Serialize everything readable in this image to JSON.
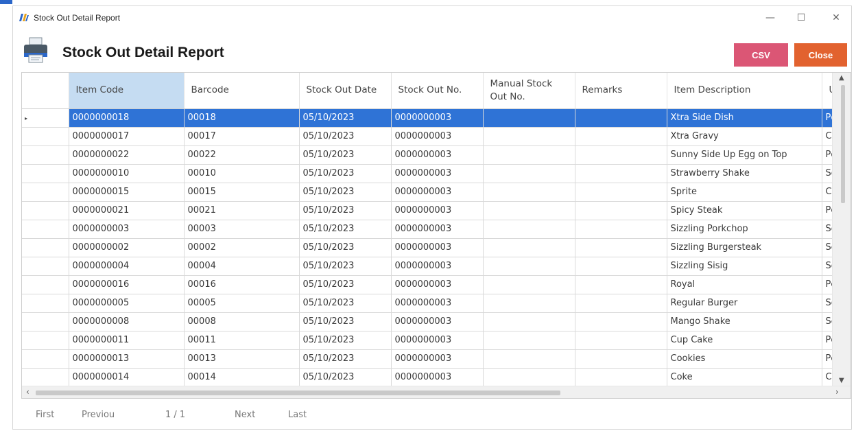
{
  "window": {
    "title": "Stock Out Detail Report",
    "minimize_glyph": "—",
    "maximize_glyph": "☐",
    "close_glyph": "✕"
  },
  "header": {
    "title": "Stock Out Detail Report",
    "csv_label": "CSV",
    "close_label": "Close"
  },
  "table": {
    "columns": [
      {
        "label": "Item Code"
      },
      {
        "label": "Barcode"
      },
      {
        "label": "Stock Out Date"
      },
      {
        "label": "Stock Out No."
      },
      {
        "label": "Manual Stock Out No."
      },
      {
        "label": "Remarks"
      },
      {
        "label": "Item Description"
      },
      {
        "label": "U"
      }
    ],
    "rows": [
      {
        "item_code": "0000000018",
        "barcode": "00018",
        "date": "05/10/2023",
        "stock_out_no": "0000000003",
        "manual_no": "",
        "remarks": "",
        "description": "Xtra Side Dish",
        "unit": "Pc"
      },
      {
        "item_code": "0000000017",
        "barcode": "00017",
        "date": "05/10/2023",
        "stock_out_no": "0000000003",
        "manual_no": "",
        "remarks": "",
        "description": "Xtra Gravy",
        "unit": "Cu"
      },
      {
        "item_code": "0000000022",
        "barcode": "00022",
        "date": "05/10/2023",
        "stock_out_no": "0000000003",
        "manual_no": "",
        "remarks": "",
        "description": "Sunny Side Up Egg on Top",
        "unit": "Pc"
      },
      {
        "item_code": "0000000010",
        "barcode": "00010",
        "date": "05/10/2023",
        "stock_out_no": "0000000003",
        "manual_no": "",
        "remarks": "",
        "description": "Strawberry Shake",
        "unit": "Se"
      },
      {
        "item_code": "0000000015",
        "barcode": "00015",
        "date": "05/10/2023",
        "stock_out_no": "0000000003",
        "manual_no": "",
        "remarks": "",
        "description": "Sprite",
        "unit": "Ca"
      },
      {
        "item_code": "0000000021",
        "barcode": "00021",
        "date": "05/10/2023",
        "stock_out_no": "0000000003",
        "manual_no": "",
        "remarks": "",
        "description": "Spicy Steak",
        "unit": "Pc"
      },
      {
        "item_code": "0000000003",
        "barcode": "00003",
        "date": "05/10/2023",
        "stock_out_no": "0000000003",
        "manual_no": "",
        "remarks": "",
        "description": "Sizzling Porkchop",
        "unit": "Se"
      },
      {
        "item_code": "0000000002",
        "barcode": "00002",
        "date": "05/10/2023",
        "stock_out_no": "0000000003",
        "manual_no": "",
        "remarks": "",
        "description": "Sizzling Burgersteak",
        "unit": "Se"
      },
      {
        "item_code": "0000000004",
        "barcode": "00004",
        "date": "05/10/2023",
        "stock_out_no": "0000000003",
        "manual_no": "",
        "remarks": "",
        "description": "Sizzling  Sisig",
        "unit": "Se"
      },
      {
        "item_code": "0000000016",
        "barcode": "00016",
        "date": "05/10/2023",
        "stock_out_no": "0000000003",
        "manual_no": "",
        "remarks": "",
        "description": "Royal",
        "unit": "Pc"
      },
      {
        "item_code": "0000000005",
        "barcode": "00005",
        "date": "05/10/2023",
        "stock_out_no": "0000000003",
        "manual_no": "",
        "remarks": "",
        "description": "Regular Burger",
        "unit": "Se"
      },
      {
        "item_code": "0000000008",
        "barcode": "00008",
        "date": "05/10/2023",
        "stock_out_no": "0000000003",
        "manual_no": "",
        "remarks": "",
        "description": "Mango Shake",
        "unit": "Se"
      },
      {
        "item_code": "0000000011",
        "barcode": "00011",
        "date": "05/10/2023",
        "stock_out_no": "0000000003",
        "manual_no": "",
        "remarks": "",
        "description": "Cup Cake",
        "unit": "Pc"
      },
      {
        "item_code": "0000000013",
        "barcode": "00013",
        "date": "05/10/2023",
        "stock_out_no": "0000000003",
        "manual_no": "",
        "remarks": "",
        "description": "Cookies",
        "unit": "Pc"
      },
      {
        "item_code": "0000000014",
        "barcode": "00014",
        "date": "05/10/2023",
        "stock_out_no": "0000000003",
        "manual_no": "",
        "remarks": "",
        "description": "Coke",
        "unit": "Ca"
      }
    ],
    "selected_row_indicator": "▸"
  },
  "pager": {
    "first": "First",
    "previous": "Previou",
    "page": "1 / 1",
    "next": "Next",
    "last": "Last"
  },
  "colors": {
    "csv_button": "#db5675",
    "close_button": "#e2622f",
    "selected_row": "#2f73d6",
    "sorted_header": "#c5dcf2"
  },
  "icons": [
    "app-logo-icon",
    "printer-icon",
    "scroll-up-arrow-icon",
    "scroll-down-arrow-icon",
    "scroll-left-arrow-icon",
    "scroll-right-arrow-icon"
  ]
}
